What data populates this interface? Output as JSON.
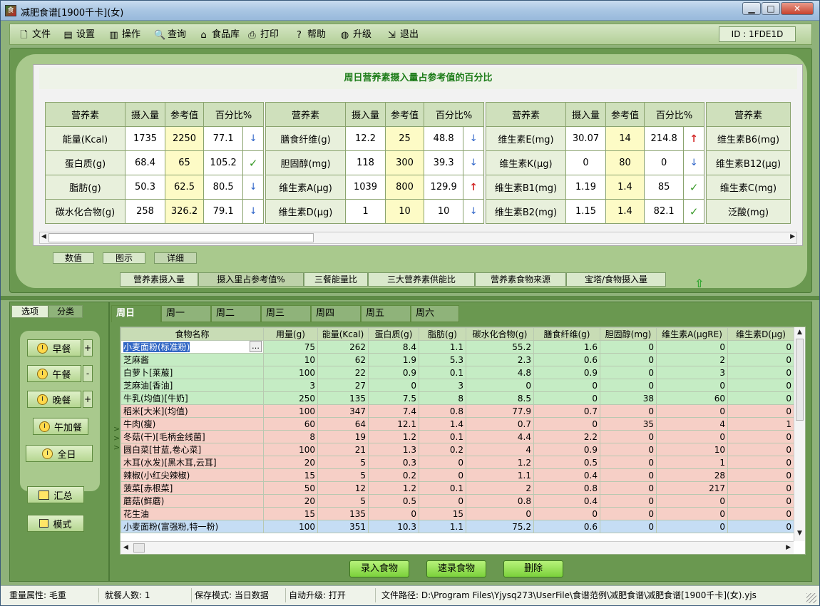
{
  "window": {
    "title": "减肥食谱[1900千卡](女)",
    "controls": [
      "min",
      "max",
      "close"
    ]
  },
  "menu": {
    "items": [
      {
        "label": "文件",
        "icon": "file-icon"
      },
      {
        "label": "设置",
        "icon": "settings-icon"
      },
      {
        "label": "操作",
        "icon": "chart-icon"
      },
      {
        "label": "查询",
        "icon": "search-icon"
      },
      {
        "label": "食品库",
        "icon": "house-icon"
      },
      {
        "label": "打印",
        "icon": "printer-icon"
      },
      {
        "label": "帮助",
        "icon": "help-icon"
      },
      {
        "label": "升级",
        "icon": "globe-icon"
      },
      {
        "label": "退出",
        "icon": "exit-icon"
      }
    ],
    "id_label": "ID : 1FDE1D"
  },
  "summary": {
    "title": "周日营养素摄入量占参考值的百分比",
    "headers": [
      "营养素",
      "摄入量",
      "参考值",
      "百分比%"
    ],
    "group1": [
      {
        "name": "能量(Kcal)",
        "intake": "1735",
        "ref": "2250",
        "pct": "77.1",
        "flag": "down"
      },
      {
        "name": "蛋白质(g)",
        "intake": "68.4",
        "ref": "65",
        "pct": "105.2",
        "flag": "ok"
      },
      {
        "name": "脂肪(g)",
        "intake": "50.3",
        "ref": "62.5",
        "pct": "80.5",
        "flag": "down"
      },
      {
        "name": "碳水化合物(g)",
        "intake": "258",
        "ref": "326.2",
        "pct": "79.1",
        "flag": "down"
      }
    ],
    "group2": [
      {
        "name": "膳食纤维(g)",
        "intake": "12.2",
        "ref": "25",
        "pct": "48.8",
        "flag": "down"
      },
      {
        "name": "胆固醇(mg)",
        "intake": "118",
        "ref": "300",
        "pct": "39.3",
        "flag": "down"
      },
      {
        "name": "维生素A(μg)",
        "intake": "1039",
        "ref": "800",
        "pct": "129.9",
        "flag": "up"
      },
      {
        "name": "维生素D(μg)",
        "intake": "1",
        "ref": "10",
        "pct": "10",
        "flag": "down"
      }
    ],
    "group3": [
      {
        "name": "维生素E(mg)",
        "intake": "30.07",
        "ref": "14",
        "pct": "214.8",
        "flag": "up"
      },
      {
        "name": "维生素K(μg)",
        "intake": "0",
        "ref": "80",
        "pct": "0",
        "flag": "down"
      },
      {
        "name": "维生素B1(mg)",
        "intake": "1.19",
        "ref": "1.4",
        "pct": "85",
        "flag": "ok"
      },
      {
        "name": "维生素B2(mg)",
        "intake": "1.15",
        "ref": "1.4",
        "pct": "82.1",
        "flag": "ok"
      }
    ],
    "group4": [
      {
        "name": "维生素B6(mg)"
      },
      {
        "name": "维生素B12(μg)"
      },
      {
        "name": "维生素C(mg)"
      },
      {
        "name": "泛酸(mg)"
      }
    ],
    "view_tabs": [
      "数值",
      "图示",
      "详细"
    ],
    "bottom_tabs": [
      "营养素摄入量",
      "摄入里占参考值%",
      "三餐能量比",
      "三大营养素供能比",
      "营养素食物来源",
      "宝塔/食物摄入量"
    ]
  },
  "left_panel": {
    "tabs": [
      "选项",
      "分类"
    ],
    "meals": [
      {
        "label": "早餐",
        "pm": "+"
      },
      {
        "label": "午餐",
        "pm": "-"
      },
      {
        "label": "晚餐",
        "pm": "+"
      },
      {
        "label": "午加餐",
        "pm": ""
      }
    ],
    "all_day": "全日",
    "summary_btn": "汇总",
    "mode_btn": "模式"
  },
  "days": [
    "周日",
    "周一",
    "周二",
    "周三",
    "周四",
    "周五",
    "周六"
  ],
  "food_table": {
    "columns": [
      "食物名称",
      "用量(g)",
      "能量(Kcal)",
      "蛋白质(g)",
      "脂肪(g)",
      "碳水化合物(g)",
      "膳食纤维(g)",
      "胆固醇(mg)",
      "维生素A(μgRE)",
      "维生素D(μg)"
    ],
    "rows": [
      {
        "c": "g",
        "v": [
          "小麦面粉(标准粉)",
          "75",
          "262",
          "8.4",
          "1.1",
          "55.2",
          "1.6",
          "0",
          "0",
          "0"
        ]
      },
      {
        "c": "g",
        "v": [
          "芝麻酱",
          "10",
          "62",
          "1.9",
          "5.3",
          "2.3",
          "0.6",
          "0",
          "2",
          "0"
        ]
      },
      {
        "c": "g",
        "v": [
          "白萝卜[莱菔]",
          "100",
          "22",
          "0.9",
          "0.1",
          "4.8",
          "0.9",
          "0",
          "3",
          "0"
        ]
      },
      {
        "c": "g",
        "v": [
          "芝麻油[香油]",
          "3",
          "27",
          "0",
          "3",
          "0",
          "0",
          "0",
          "0",
          "0"
        ]
      },
      {
        "c": "g",
        "v": [
          "牛乳(均值)[牛奶]",
          "250",
          "135",
          "7.5",
          "8",
          "8.5",
          "0",
          "38",
          "60",
          "0"
        ]
      },
      {
        "c": "r",
        "v": [
          "稻米[大米](均值)",
          "100",
          "347",
          "7.4",
          "0.8",
          "77.9",
          "0.7",
          "0",
          "0",
          "0"
        ]
      },
      {
        "c": "r",
        "v": [
          "牛肉(瘦)",
          "60",
          "64",
          "12.1",
          "1.4",
          "0.7",
          "0",
          "35",
          "4",
          "1"
        ]
      },
      {
        "c": "r",
        "v": [
          "冬菇(干)[毛柄金线菌]",
          "8",
          "19",
          "1.2",
          "0.1",
          "4.4",
          "2.2",
          "0",
          "0",
          "0"
        ]
      },
      {
        "c": "r",
        "v": [
          "圆白菜[甘蓝,卷心菜]",
          "100",
          "21",
          "1.3",
          "0.2",
          "4",
          "0.9",
          "0",
          "10",
          "0"
        ]
      },
      {
        "c": "r",
        "v": [
          "木耳(水发)[黑木耳,云耳]",
          "20",
          "5",
          "0.3",
          "0",
          "1.2",
          "0.5",
          "0",
          "1",
          "0"
        ]
      },
      {
        "c": "r",
        "v": [
          "辣椒(小红尖辣椒)",
          "15",
          "5",
          "0.2",
          "0",
          "1.1",
          "0.4",
          "0",
          "28",
          "0"
        ]
      },
      {
        "c": "r",
        "v": [
          "菠菜[赤根菜]",
          "50",
          "12",
          "1.2",
          "0.1",
          "2",
          "0.8",
          "0",
          "217",
          "0"
        ]
      },
      {
        "c": "r",
        "v": [
          "蘑菇(鲜蘑)",
          "20",
          "5",
          "0.5",
          "0",
          "0.8",
          "0.4",
          "0",
          "0",
          "0"
        ]
      },
      {
        "c": "r",
        "v": [
          "花生油",
          "15",
          "135",
          "0",
          "15",
          "0",
          "0",
          "0",
          "0",
          "0"
        ]
      },
      {
        "c": "b",
        "v": [
          "小麦面粉(富强粉,特一粉)",
          "100",
          "351",
          "10.3",
          "1.1",
          "75.2",
          "0.6",
          "0",
          "0",
          "0"
        ]
      }
    ]
  },
  "actions": [
    "录入食物",
    "速录食物",
    "删除"
  ],
  "status": [
    "重量属性: 毛重",
    "就餐人数: 1",
    "保存模式: 当日数据",
    "自动升级: 打开",
    "文件路径: D:\\Program Files\\Yjysq273\\UserFile\\食谱范例\\减肥食谱\\减肥食谱[1900千卡](女).yjs"
  ],
  "colors": {
    "accent_green": "#6a9850",
    "ref_yellow": "#fdfbc6",
    "row_green": "#c5ecc4",
    "row_red": "#f6cfc6",
    "row_blue": "#c5ddf4"
  }
}
